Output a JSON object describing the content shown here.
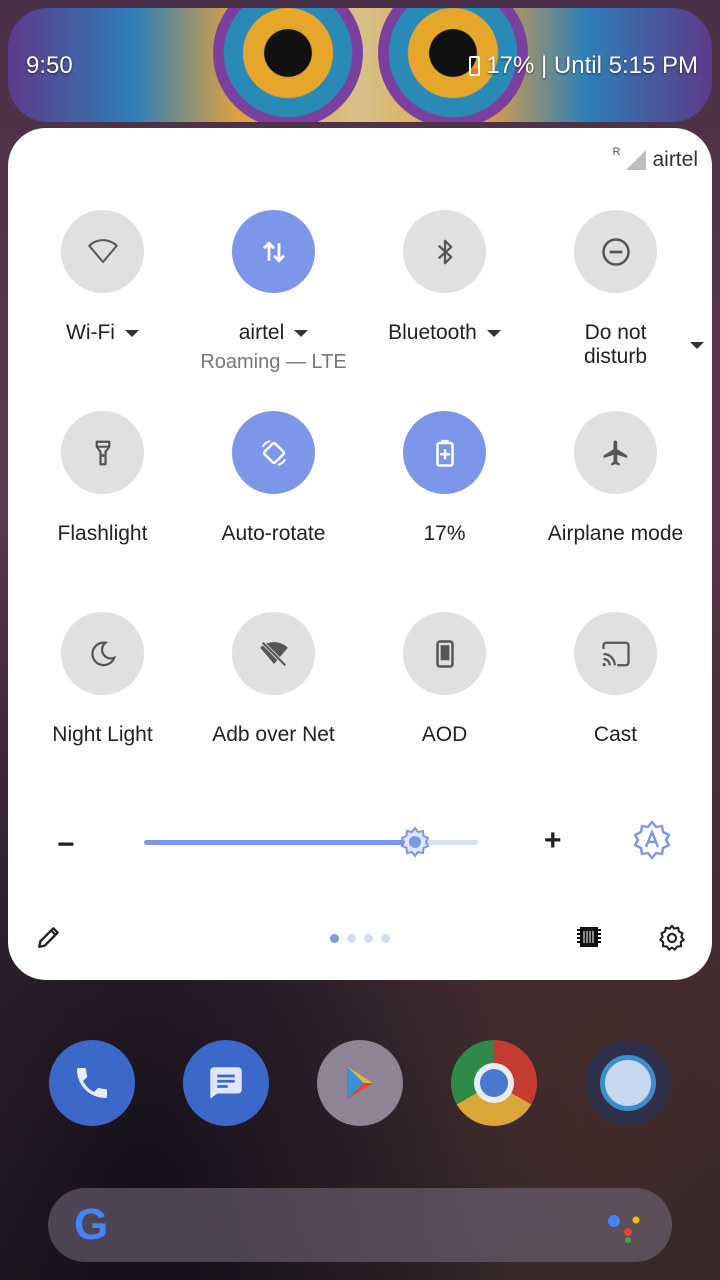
{
  "status_bar": {
    "time": "9:50",
    "battery_text": "17% | Until 5:15 PM"
  },
  "carrier": {
    "roaming_marker": "R",
    "name": "airtel"
  },
  "tiles": [
    {
      "id": "wifi",
      "label": "Wi-Fi",
      "sub": "",
      "active": false,
      "has_menu": true,
      "icon": "wifi-icon"
    },
    {
      "id": "data",
      "label": "airtel",
      "sub": "Roaming — LTE",
      "active": true,
      "has_menu": true,
      "icon": "mobile-data-icon"
    },
    {
      "id": "bluetooth",
      "label": "Bluetooth",
      "sub": "",
      "active": false,
      "has_menu": true,
      "icon": "bluetooth-icon"
    },
    {
      "id": "dnd",
      "label": "Do not disturb",
      "label_line1": "Do not",
      "label_line2": "disturb",
      "sub": "",
      "active": false,
      "has_menu": true,
      "icon": "do-not-disturb-icon"
    },
    {
      "id": "flashlight",
      "label": "Flashlight",
      "active": false,
      "icon": "flashlight-icon"
    },
    {
      "id": "autorotate",
      "label": "Auto-rotate",
      "active": true,
      "icon": "auto-rotate-icon"
    },
    {
      "id": "battery",
      "label": "17%",
      "active": true,
      "icon": "battery-saver-icon"
    },
    {
      "id": "airplane",
      "label": "Airplane mode",
      "active": false,
      "icon": "airplane-icon"
    },
    {
      "id": "nightlight",
      "label": "Night Light",
      "active": false,
      "icon": "moon-icon"
    },
    {
      "id": "adb",
      "label": "Adb over Net",
      "active": false,
      "icon": "wifi-off-icon"
    },
    {
      "id": "aod",
      "label": "AOD",
      "active": false,
      "icon": "phone-icon"
    },
    {
      "id": "cast",
      "label": "Cast",
      "active": false,
      "icon": "cast-icon"
    }
  ],
  "brightness": {
    "minus": "−",
    "plus": "+",
    "level": 0.81
  },
  "pager": {
    "pages": 4,
    "current": 0
  },
  "colors": {
    "accent": "#7c97ea",
    "tile_off": "#e0e0e0",
    "panel": "#ffffff"
  }
}
